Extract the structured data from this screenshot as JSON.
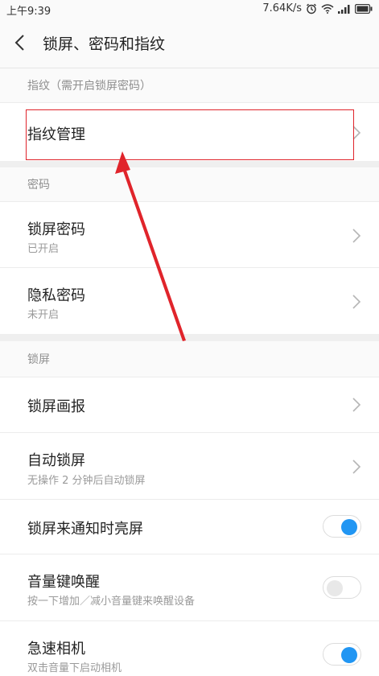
{
  "status_bar": {
    "time": "上午9:39",
    "speed": "7.64K/s"
  },
  "header": {
    "title": "锁屏、密码和指纹"
  },
  "sections": {
    "fingerprint": {
      "header": "指纹（需开启锁屏密码）",
      "items": [
        {
          "title": "指纹管理"
        }
      ]
    },
    "password": {
      "header": "密码",
      "items": [
        {
          "title": "锁屏密码",
          "subtitle": "已开启"
        },
        {
          "title": "隐私密码",
          "subtitle": "未开启"
        }
      ]
    },
    "lockscreen": {
      "header": "锁屏",
      "items": [
        {
          "title": "锁屏画报"
        },
        {
          "title": "自动锁屏",
          "subtitle": "无操作 2 分钟后自动锁屏"
        },
        {
          "title": "锁屏来通知时亮屏",
          "toggle": "on"
        },
        {
          "title": "音量键唤醒",
          "subtitle": "按一下增加／减小音量键来唤醒设备",
          "toggle": "off"
        },
        {
          "title": "急速相机",
          "subtitle": "双击音量下启动相机",
          "toggle": "on"
        }
      ]
    }
  },
  "colors": {
    "accent": "#2196f3",
    "annotation": "#e0242b"
  },
  "icons": {
    "back": "back-arrow-icon",
    "chevron": "chevron-right-icon",
    "alarm": "alarm-clock-icon",
    "wifi": "wifi-icon",
    "signal": "signal-icon",
    "battery": "battery-icon"
  }
}
